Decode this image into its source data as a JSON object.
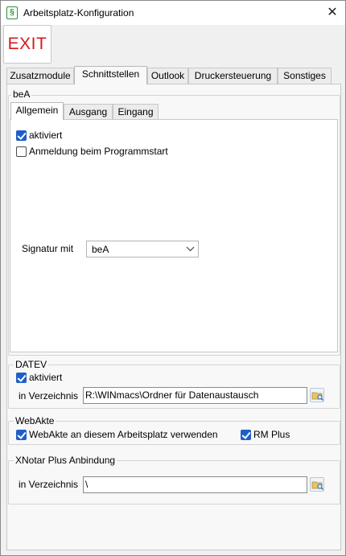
{
  "window": {
    "title": "Arbeitsplatz-Konfiguration",
    "icon": "document-paragraph-icon",
    "close_symbol": "✕"
  },
  "toolbar": {
    "exit_label": "EXIT"
  },
  "tabs": [
    {
      "label": "Zusatzmodule",
      "active": false
    },
    {
      "label": "Schnittstellen",
      "active": true
    },
    {
      "label": "Outlook",
      "active": false
    },
    {
      "label": "Druckersteuerung",
      "active": false
    },
    {
      "label": "Sonstiges",
      "active": false
    }
  ],
  "bea": {
    "group_label": "beA",
    "subtabs": [
      {
        "label": "Allgemein",
        "active": true
      },
      {
        "label": "Ausgang",
        "active": false
      },
      {
        "label": "Eingang",
        "active": false
      }
    ],
    "aktiviert_label": "aktiviert",
    "aktiviert_checked": true,
    "anmeldung_label": "Anmeldung beim Programmstart",
    "anmeldung_checked": false,
    "signatur_label": "Signatur mit",
    "signatur_value": "beA"
  },
  "datev": {
    "group_label": "DATEV",
    "aktiviert_label": "aktiviert",
    "aktiviert_checked": true,
    "verzeichnis_label": "in Verzeichnis",
    "verzeichnis_value": "R:\\WINmacs\\Ordner für Datenaustausch"
  },
  "webakte": {
    "group_label": "WebAkte",
    "use_label": "WebAkte an diesem Arbeitsplatz verwenden",
    "use_checked": true,
    "rmplus_label": "RM Plus",
    "rmplus_checked": true
  },
  "xnotar": {
    "group_label": "XNotar Plus Anbindung",
    "verzeichnis_label": "in Verzeichnis",
    "verzeichnis_value": "\\"
  },
  "colors": {
    "exit_text": "#d81818",
    "checkbox_checked": "#1d5fc8",
    "app_icon": "#2f8f3a"
  }
}
